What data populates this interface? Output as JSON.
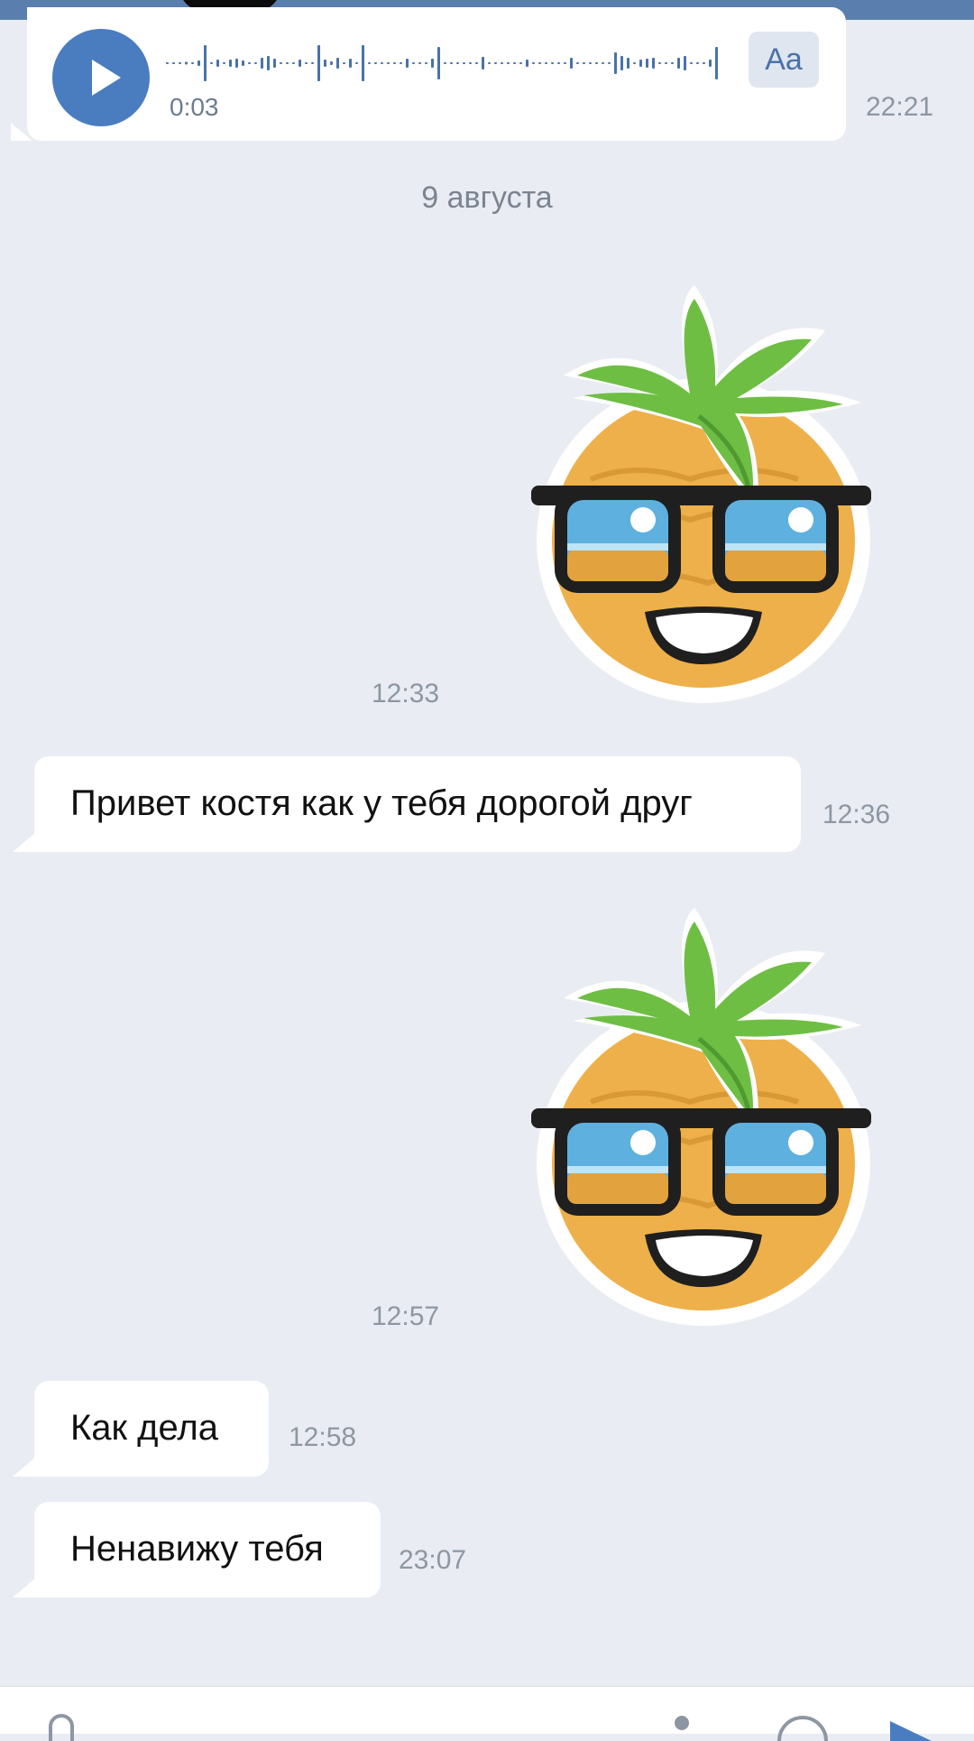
{
  "voice_message": {
    "duration": "0:03",
    "transcribe_label": "Aa",
    "time": "22:21"
  },
  "date_separator": "9 августа",
  "messages": [
    {
      "type": "sticker",
      "sticker": "pineapple-sunglasses-sticker",
      "time": "12:33"
    },
    {
      "type": "text",
      "text": "Привет костя как у тебя дорогой друг",
      "time": "12:36"
    },
    {
      "type": "sticker",
      "sticker": "pineapple-sunglasses-sticker",
      "time": "12:57"
    },
    {
      "type": "text",
      "text": "Как дела",
      "time": "12:58"
    },
    {
      "type": "text",
      "text": "Ненавижу тебя",
      "time": "23:07"
    }
  ],
  "icons": {
    "play": "play-icon",
    "attach": "paperclip-icon",
    "mic": "microphone-icon",
    "emoji": "emoji-icon",
    "send": "send-icon"
  },
  "colors": {
    "background": "#e9ecf2",
    "accent": "#4a7cc0",
    "header": "#5a7fae",
    "bubble": "#ffffff",
    "timestamp": "#8d97a3"
  }
}
